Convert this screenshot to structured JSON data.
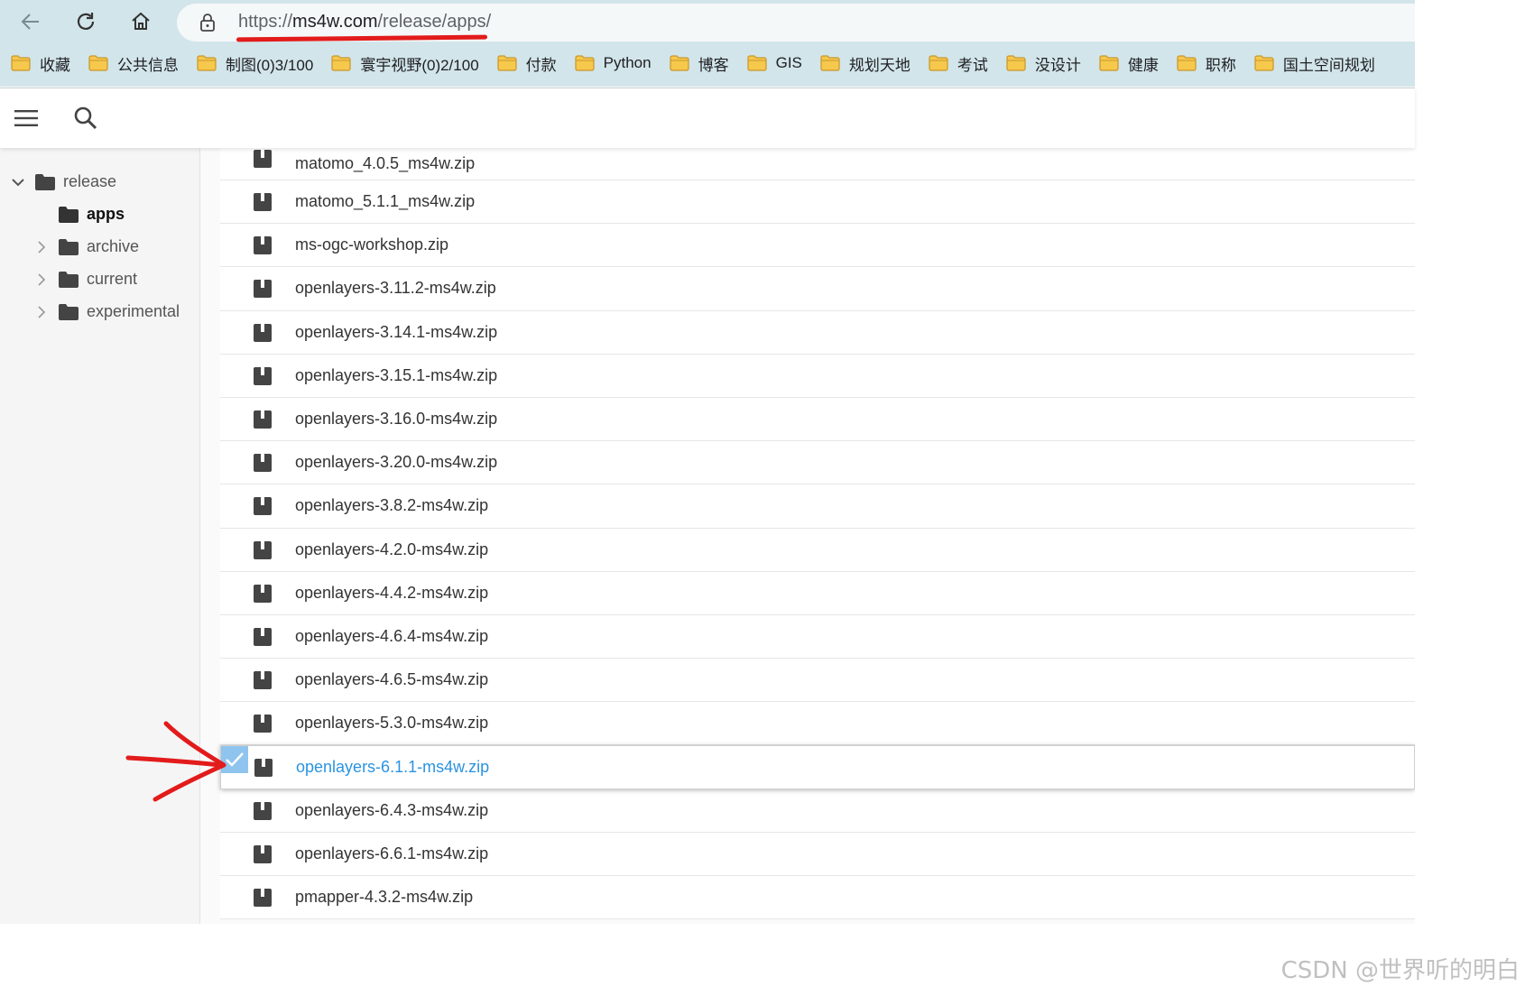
{
  "browser": {
    "url_scheme": "https://",
    "url_host": "ms4w.com",
    "url_path": "/release/apps/",
    "bookmarks": [
      "收藏",
      "公共信息",
      "制图(0)3/100",
      "寰宇视野(0)2/100",
      "付款",
      "Python",
      "博客",
      "GIS",
      "规划天地",
      "考试",
      "没设计",
      "健康",
      "职称",
      "国土空间规划"
    ]
  },
  "sidebar": {
    "root": "release",
    "items": [
      "apps",
      "archive",
      "current",
      "experimental"
    ]
  },
  "files": [
    "matomo_4.0.5_ms4w.zip",
    "matomo_5.1.1_ms4w.zip",
    "ms-ogc-workshop.zip",
    "openlayers-3.11.2-ms4w.zip",
    "openlayers-3.14.1-ms4w.zip",
    "openlayers-3.15.1-ms4w.zip",
    "openlayers-3.16.0-ms4w.zip",
    "openlayers-3.20.0-ms4w.zip",
    "openlayers-3.8.2-ms4w.zip",
    "openlayers-4.2.0-ms4w.zip",
    "openlayers-4.4.2-ms4w.zip",
    "openlayers-4.6.4-ms4w.zip",
    "openlayers-4.6.5-ms4w.zip",
    "openlayers-5.3.0-ms4w.zip",
    "openlayers-6.1.1-ms4w.zip",
    "openlayers-6.4.3-ms4w.zip",
    "openlayers-6.6.1-ms4w.zip",
    "pmapper-4.3.2-ms4w.zip"
  ],
  "selected_file": "openlayers-6.1.1-ms4w.zip",
  "colors": {
    "chrome": "#d2e5ea",
    "selected_link": "#2b93e0",
    "annotation": "#e21b1b",
    "folder_bookmark": "#f6c84c"
  },
  "watermark": "CSDN @世界听的明白"
}
